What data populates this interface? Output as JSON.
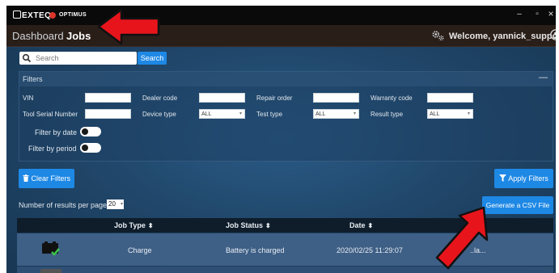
{
  "titlebar": {
    "logo": "EXTEQ",
    "app_name": "OPTIMUS",
    "minimize": "–",
    "maximize": "▫",
    "close": "×"
  },
  "nav": {
    "dashboard_label": "Dashboard",
    "jobs_label": "Jobs",
    "welcome_text": "Welcome, yannick_support"
  },
  "search": {
    "placeholder": "Search",
    "button_label": "Search"
  },
  "filters": {
    "title": "Filters",
    "collapse_symbol": "—",
    "vin_label": "VIN",
    "dealer_code_label": "Dealer code",
    "repair_order_label": "Repair order",
    "warranty_code_label": "Warranty code",
    "tool_serial_label": "Tool Serial Number",
    "device_type_label": "Device type",
    "device_type_value": "ALL",
    "test_type_label": "Test type",
    "test_type_value": "ALL",
    "result_type_label": "Result type",
    "result_type_value": "ALL",
    "filter_by_date_label": "Filter by date",
    "filter_by_period_label": "Filter by period",
    "clear_filters_label": "Clear Filters",
    "apply_filters_label": "Apply Filters"
  },
  "results": {
    "per_page_label": "Number of results per page:",
    "per_page_value": "20",
    "csv_button_label": "Generate a CSV File"
  },
  "table": {
    "columns": {
      "job_type": "Job Type",
      "job_status": "Job Status",
      "date": "Date"
    },
    "sort_symbol": "⬍",
    "rows": [
      {
        "job_type": "Charge",
        "job_status": "Battery is charged",
        "date": "2020/02/25 11:29:07",
        "extra": "..la..."
      }
    ]
  },
  "colors": {
    "accent": "#1e88e5",
    "titlebar": "#0a0a0a",
    "navbar": "#2a1e19",
    "annotation_arrow": "#e8141b"
  },
  "icons": [
    "gear-icon",
    "user-icon",
    "search-icon",
    "trash-icon",
    "filter-icon",
    "battery-charge-icon",
    "sort-icon"
  ]
}
